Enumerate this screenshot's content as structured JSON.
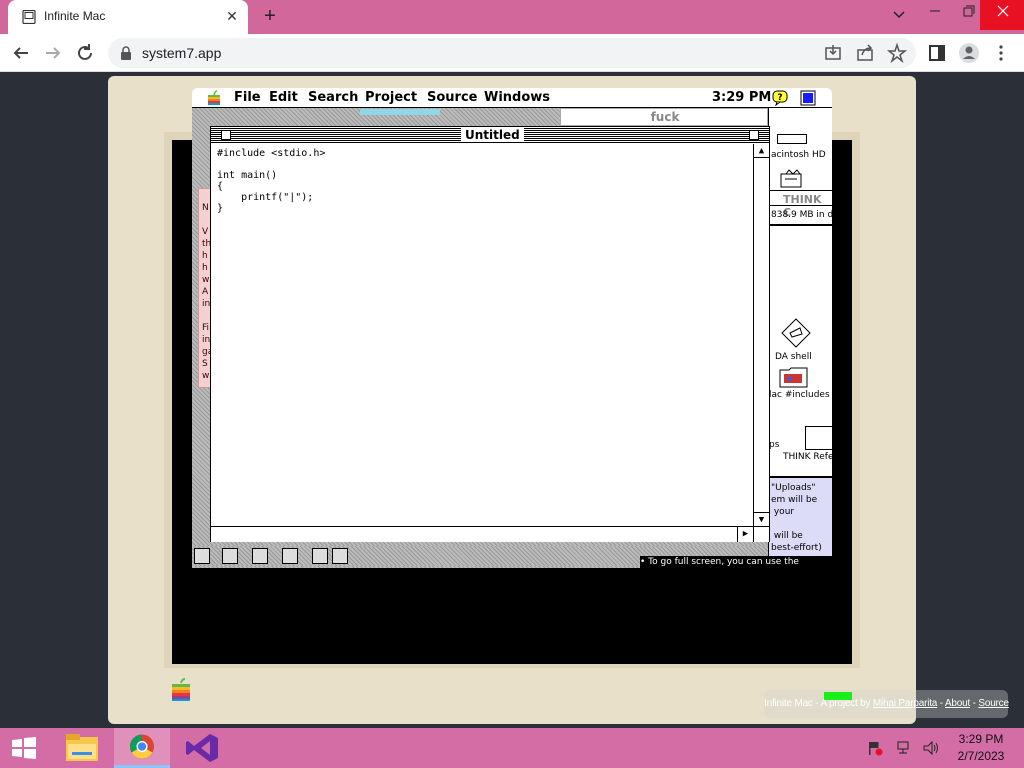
{
  "browser": {
    "tab_title": "Infinite Mac",
    "url": "system7.app",
    "colors": {
      "tabstrip": "#d2679c",
      "close_hover": "#e81123"
    }
  },
  "mac": {
    "menu": {
      "file": "File",
      "edit": "Edit",
      "search": "Search",
      "project": "Project",
      "source": "Source",
      "windows": "Windows",
      "clock": "3:29 PM"
    },
    "background_window_title": "fuck",
    "editor": {
      "title": "Untitled",
      "code": "#include <stdio.h>\n\nint main()\n{\n    printf(\"|\");\n}"
    },
    "finder": {
      "hd_label": "acintosh HD",
      "think_label": "THINK C",
      "disk_free": "838.9 MB in d",
      "da_shell": "DA shell",
      "includes": "lac #includes",
      "ps": "ps",
      "think_ref": "THINK Refe",
      "note": "\"Uploads\"\nem will be\n your\n\n will be\nbest-effort)"
    },
    "pink_doc": "N\n\nV\nth\nh\nh\nw\nA\nin\n\nFi\nin\nga\nS\nw",
    "bottom_hint": "• To go full screen, you can use the"
  },
  "credits": {
    "prefix": "Infinite Mac - A project by ",
    "author": "Mihai Parparita",
    "sep1": " - ",
    "about": "About",
    "sep2": " - ",
    "source": "Source"
  },
  "taskbar": {
    "time": "3:29 PM",
    "date": "2/7/2023",
    "color": "#d46da6"
  }
}
